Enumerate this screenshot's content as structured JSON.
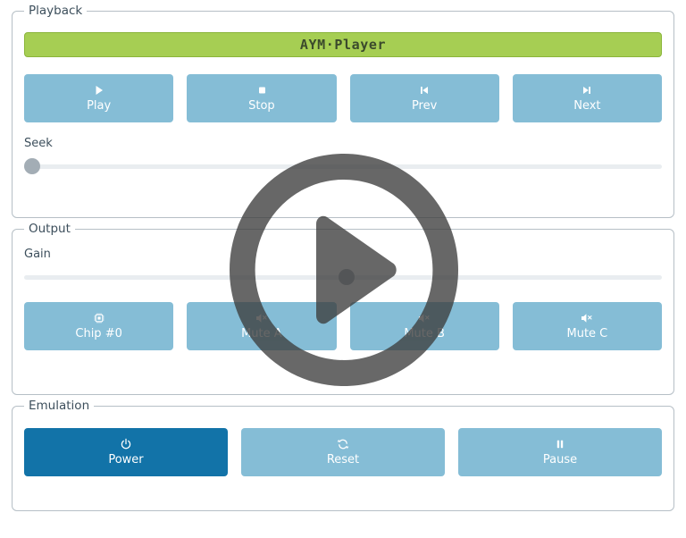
{
  "app": {
    "title": "AYM·Player",
    "accent_green": "#a6ce53",
    "accent_blue": "#85bdd6",
    "accent_blue_active": "#1273a8",
    "text_color": "#3d4f5c"
  },
  "playback": {
    "legend": "Playback",
    "banner_label": "AYM·Player",
    "buttons": [
      {
        "label": "Play",
        "icon": "play-icon",
        "state": "normal"
      },
      {
        "label": "Stop",
        "icon": "stop-icon",
        "state": "normal"
      },
      {
        "label": "Prev",
        "icon": "skip-back-icon",
        "state": "normal"
      },
      {
        "label": "Next",
        "icon": "skip-forward-icon",
        "state": "normal"
      }
    ],
    "seek": {
      "label": "Seek",
      "value": 0,
      "min": 0,
      "max": 100
    }
  },
  "output": {
    "legend": "Output",
    "gain": {
      "label": "Gain",
      "value": 50,
      "min": 0,
      "max": 100
    },
    "buttons": [
      {
        "label": "Chip #0",
        "icon": "microchip-icon",
        "state": "normal"
      },
      {
        "label": "Mute A",
        "icon": "speaker-mute-icon",
        "state": "normal"
      },
      {
        "label": "Mute B",
        "icon": "speaker-mute-icon",
        "state": "normal"
      },
      {
        "label": "Mute C",
        "icon": "speaker-mute-icon",
        "state": "normal"
      }
    ]
  },
  "emulation": {
    "legend": "Emulation",
    "buttons": [
      {
        "label": "Power",
        "icon": "power-icon",
        "state": "active"
      },
      {
        "label": "Reset",
        "icon": "refresh-icon",
        "state": "normal"
      },
      {
        "label": "Pause",
        "icon": "pause-icon",
        "state": "normal"
      }
    ]
  },
  "overlay": {
    "icon": "play-circle-overlay-icon",
    "color": "#3d3d3d",
    "opacity": 0.78
  }
}
